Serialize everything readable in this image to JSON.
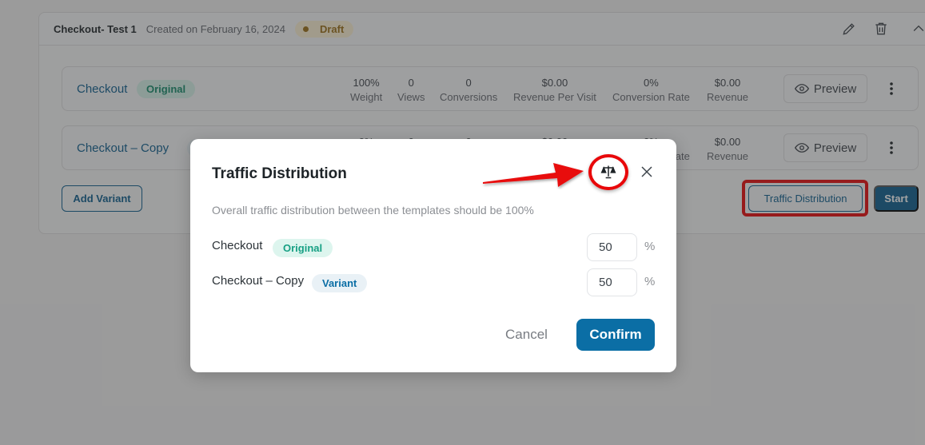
{
  "experiment": {
    "title": "Checkout- Test 1",
    "created": "Created on February 16, 2024",
    "status": "Draft",
    "icons": [
      "edit-icon",
      "trash-icon",
      "chevron-up-icon"
    ]
  },
  "metric_labels": [
    "Weight",
    "Views",
    "Conversions",
    "Revenue Per Visit",
    "Conversion Rate",
    "Revenue"
  ],
  "variants": [
    {
      "name": "Checkout",
      "tag": "Original",
      "metrics": [
        "100%",
        "0",
        "0",
        "$0.00",
        "0%",
        "$0.00"
      ],
      "preview_label": "Preview"
    },
    {
      "name": "Checkout – Copy",
      "tag": "Variant",
      "metrics": [
        "0%",
        "0",
        "0",
        "$0.00",
        "0%",
        "$0.00"
      ],
      "preview_label": "Preview"
    }
  ],
  "actions": {
    "add_variant": "Add Variant",
    "traffic_distribution": "Traffic Distribution",
    "start": "Start"
  },
  "modal": {
    "title": "Traffic Distribution",
    "description": "Overall traffic distribution between the templates should be 100%",
    "rows": [
      {
        "name": "Checkout",
        "tag": "Original",
        "value": "50",
        "unit": "%"
      },
      {
        "name": "Checkout – Copy",
        "tag": "Variant",
        "value": "50",
        "unit": "%"
      }
    ],
    "cancel_label": "Cancel",
    "confirm_label": "Confirm",
    "icons": [
      "balance-scale-icon",
      "close-icon"
    ]
  },
  "colors": {
    "primary": "#0b6ea5",
    "annotation": "#e8080a",
    "draft": "#9a6e14"
  }
}
